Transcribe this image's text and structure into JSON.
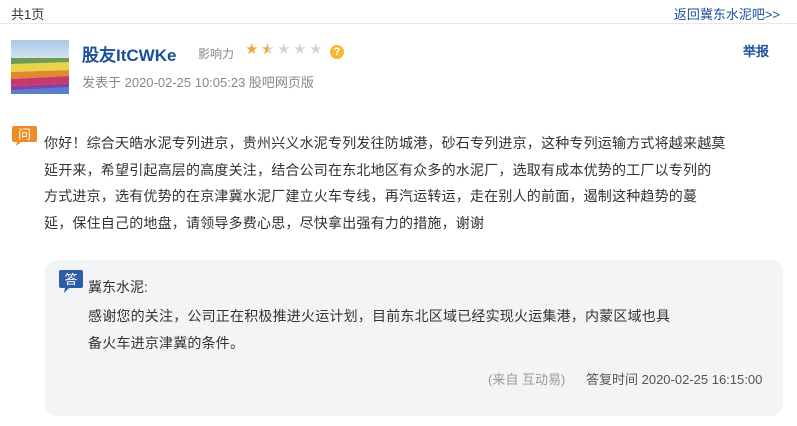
{
  "header": {
    "page_count": "共1页",
    "back_link": "返回冀东水泥吧>>"
  },
  "post": {
    "username": "股友ItCWKe",
    "influence_label": "影响力",
    "influence_rating": 1.5,
    "influence_max": 5,
    "help_icon": "?",
    "report_label": "举报",
    "meta": "发表于 2020-02-25 10:05:23 股吧网页版"
  },
  "question": {
    "icon_char": "问",
    "lines": [
      "你好！综合天皓水泥专列进京，贵州兴义水泥专列发往防城港，砂石专列进京，这种专列运输方式将越来越莫",
      "延开来，希望引起高层的高度关注，结合公司在东北地区有众多的水泥厂，选取有成本优势的工厂以专列的",
      "方式进京，选有优势的在京津冀水泥厂建立火车专线，再汽运转运，走在别人的前面，遏制这种趋势的蔓",
      "延，保住自己的地盘，请领导多费心思，尽快拿出强有力的措施，谢谢"
    ]
  },
  "answer": {
    "icon_char": "答",
    "answerer": "冀东水泥:",
    "lines": [
      "感谢您的关注，公司正在积极推进火运计划，目前东北区域已经实现火运集港，内蒙区域也具",
      "备火车进京津冀的条件。"
    ],
    "source": "(来自 互动易)",
    "time": "答复时间 2020-02-25 16:15:00"
  },
  "colors": {
    "link_blue": "#1a4f9c",
    "star_gold": "#f2a93b",
    "icon_orange": "#f08a24",
    "icon_blue": "#2e5da6",
    "answer_bg": "#f3f4f6"
  }
}
